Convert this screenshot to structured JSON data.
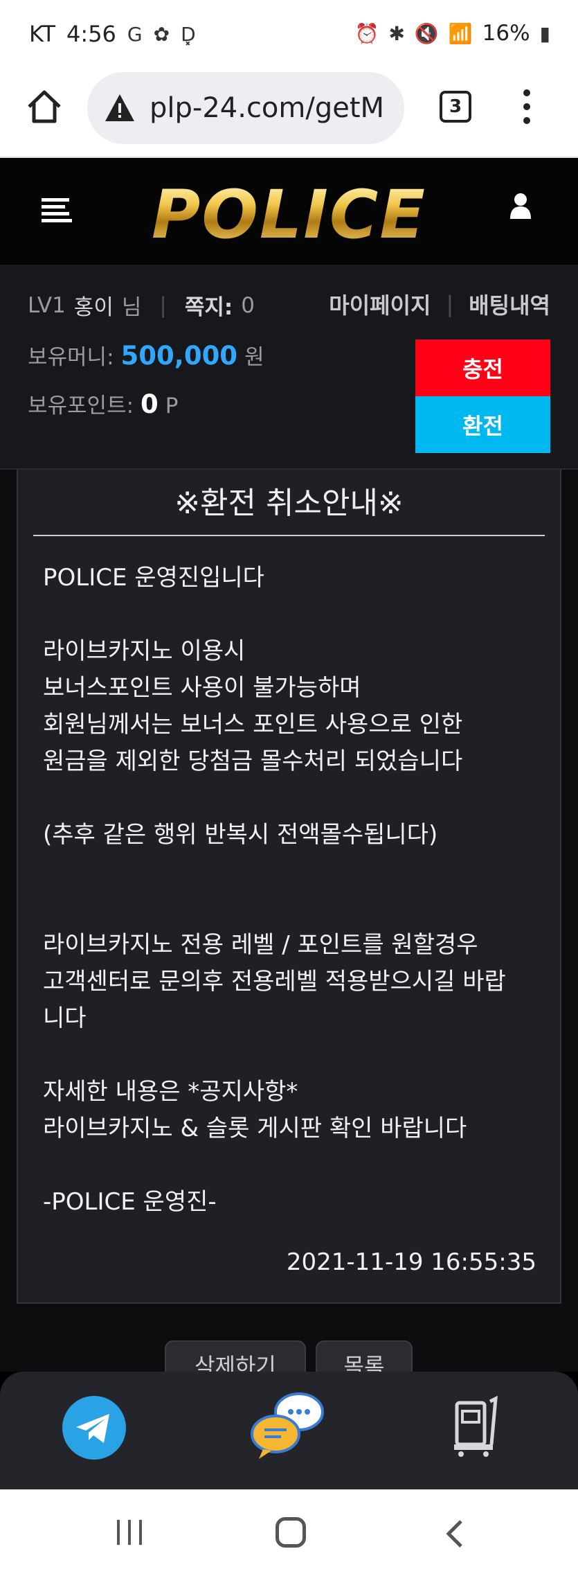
{
  "status_bar": {
    "carrier": "KT",
    "time": "4:56",
    "battery": "16%"
  },
  "browser": {
    "url": "plp-24.com/getM",
    "tab_count": "3"
  },
  "header": {
    "logo": "POLICE"
  },
  "user": {
    "level": "LV1",
    "name": "홍이",
    "honorific": "님",
    "message_label": "쪽지:",
    "message_count": "0",
    "mypage_label": "마이페이지",
    "bet_history_label": "배팅내역",
    "money_label": "보유머니:",
    "money_value": "500,000",
    "money_unit": "원",
    "point_label": "보유포인트:",
    "point_value": "0",
    "point_unit": "P",
    "charge_label": "충전",
    "exchange_label": "환전"
  },
  "notice": {
    "title": "※환전 취소안내※",
    "body": [
      "POLICE 운영진입니다",
      "",
      "라이브카지노 이용시",
      "보너스포인트 사용이 불가능하며",
      "회원님께서는 보너스 포인트 사용으로 인한",
      "원금을 제외한 당첨금 몰수처리 되었습니다",
      "",
      "(추후 같은 행위 반복시 전액몰수됩니다)",
      "",
      "",
      "라이브카지노 전용 레벨 / 포인트를 원할경우",
      "고객센터로 문의후 전용레벨 적용받으시길 바랍",
      "니다",
      "",
      "자세한 내용은 *공지사항*",
      "라이브카지노 & 슬롯 게시판 확인 바랍니다",
      "",
      "-POLICE 운영진-"
    ],
    "date": "2021-11-19 16:55:35",
    "delete_label": "삭제하기",
    "list_label": "목록"
  },
  "colors": {
    "charge": "#ff0016",
    "exchange": "#00b8f0",
    "money": "#31a8ff",
    "telegram": "#2aa3e6"
  }
}
